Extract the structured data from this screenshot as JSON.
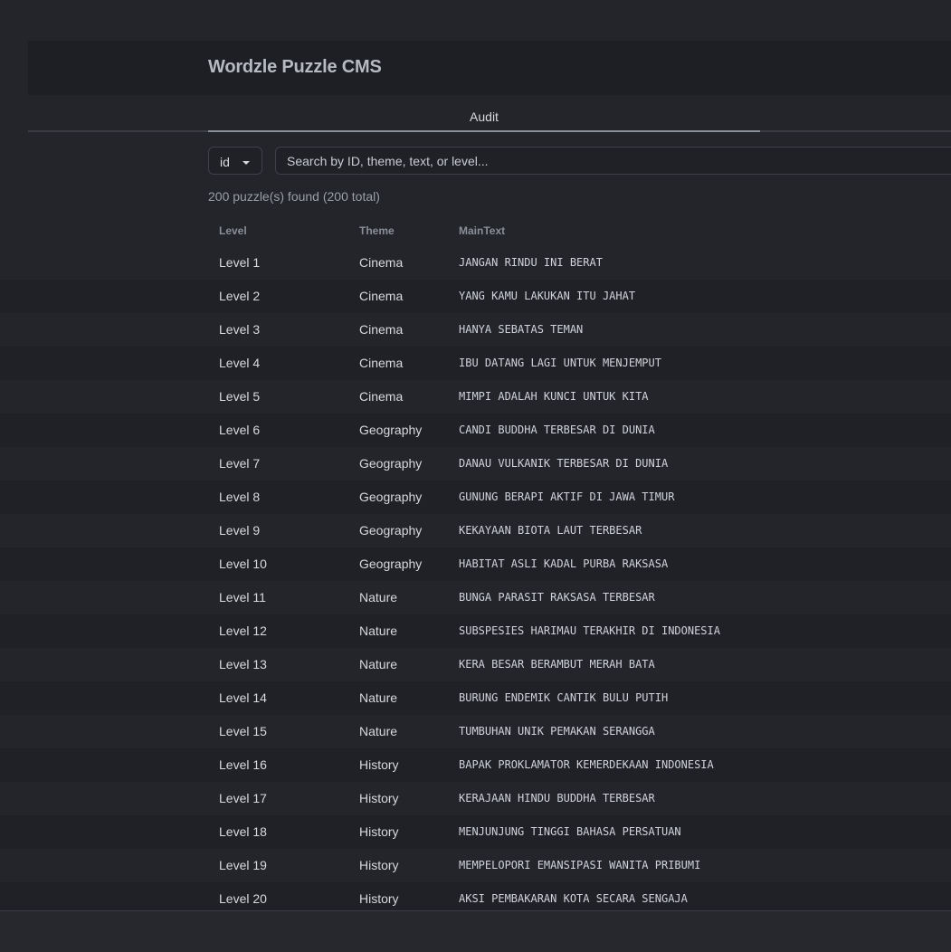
{
  "app": {
    "title": "Wordzle Puzzle CMS"
  },
  "tabs": [
    {
      "label": "Audit",
      "active": true
    }
  ],
  "filter": {
    "field": "id",
    "search_placeholder": "Search by ID, theme, text, or level..."
  },
  "results_count": "200 puzzle(s) found (200 total)",
  "table": {
    "columns": [
      "Level",
      "Theme",
      "MainText"
    ],
    "rows": [
      [
        "Level 1",
        "Cinema",
        "JANGAN RINDU INI BERAT"
      ],
      [
        "Level 2",
        "Cinema",
        "YANG KAMU LAKUKAN ITU JAHAT"
      ],
      [
        "Level 3",
        "Cinema",
        "HANYA SEBATAS TEMAN"
      ],
      [
        "Level 4",
        "Cinema",
        "IBU DATANG LAGI UNTUK MENJEMPUT"
      ],
      [
        "Level 5",
        "Cinema",
        "MIMPI ADALAH KUNCI UNTUK KITA"
      ],
      [
        "Level 6",
        "Geography",
        "CANDI BUDDHA TERBESAR DI DUNIA"
      ],
      [
        "Level 7",
        "Geography",
        "DANAU VULKANIK TERBESAR DI DUNIA"
      ],
      [
        "Level 8",
        "Geography",
        "GUNUNG BERAPI AKTIF DI JAWA TIMUR"
      ],
      [
        "Level 9",
        "Geography",
        "KEKAYAAN BIOTA LAUT TERBESAR"
      ],
      [
        "Level 10",
        "Geography",
        "HABITAT ASLI KADAL PURBA RAKSASA"
      ],
      [
        "Level 11",
        "Nature",
        "BUNGA PARASIT RAKSASA TERBESAR"
      ],
      [
        "Level 12",
        "Nature",
        "SUBSPESIES HARIMAU TERAKHIR DI INDONESIA"
      ],
      [
        "Level 13",
        "Nature",
        "KERA BESAR BERAMBUT MERAH BATA"
      ],
      [
        "Level 14",
        "Nature",
        "BURUNG ENDEMIK CANTIK BULU PUTIH"
      ],
      [
        "Level 15",
        "Nature",
        "TUMBUHAN UNIK PEMAKAN SERANGGA"
      ],
      [
        "Level 16",
        "History",
        "BAPAK PROKLAMATOR KEMERDEKAAN INDONESIA"
      ],
      [
        "Level 17",
        "History",
        "KERAJAAN HINDU BUDDHA TERBESAR"
      ],
      [
        "Level 18",
        "History",
        "MENJUNJUNG TINGGI BAHASA PERSATUAN"
      ],
      [
        "Level 19",
        "History",
        "MEMPELOPORI EMANSIPASI WANITA PRIBUMI"
      ],
      [
        "Level 20",
        "History",
        "AKSI PEMBAKARAN KOTA SECARA SENGAJA"
      ]
    ]
  },
  "colors": {
    "background": "#23252b",
    "header": "#1d1f24",
    "row_alt": "#1f2126"
  }
}
